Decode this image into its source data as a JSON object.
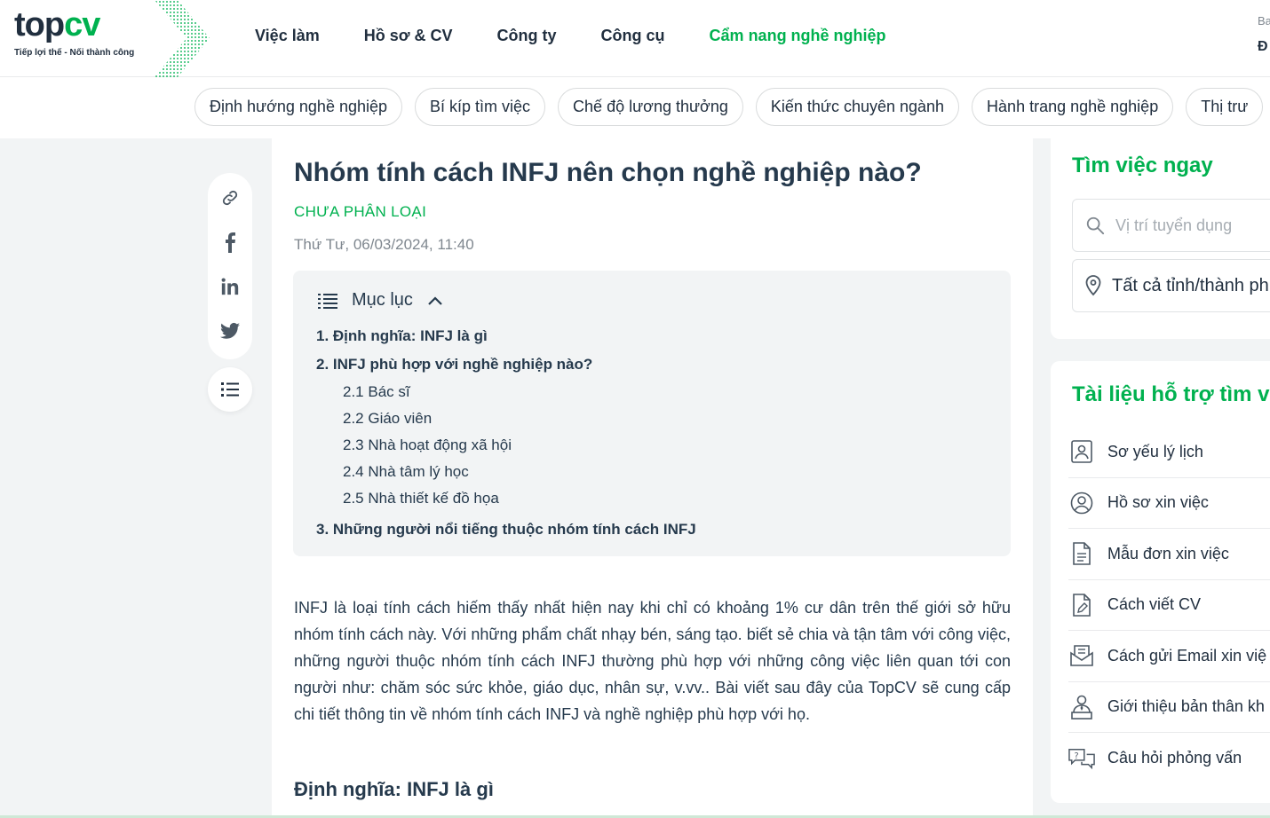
{
  "header": {
    "logo_top": "top",
    "logo_cv": "cv",
    "logo_tagline": "Tiếp lợi thế - Nối thành công",
    "nav": [
      "Việc làm",
      "Hồ sơ & CV",
      "Công ty",
      "Công cụ",
      "Cẩm nang nghề nghiệp"
    ],
    "active_nav": "Cẩm nang nghề nghiệp",
    "right_small": "Ba",
    "right_bold": "Đ"
  },
  "chips": [
    "Định hướng nghề nghiệp",
    "Bí kíp tìm việc",
    "Chế độ lương thưởng",
    "Kiến thức chuyên ngành",
    "Hành trang nghề nghiệp",
    "Thị trư"
  ],
  "article": {
    "title": "Nhóm tính cách INFJ nên chọn nghề nghiệp nào?",
    "category": "CHƯA PHÂN LOẠI",
    "date": "Thứ Tư, 06/03/2024, 11:40",
    "toc_title": "Mục lục",
    "toc": {
      "item1": "1. Định nghĩa: INFJ là gì",
      "item2": "2. INFJ phù hợp với nghề nghiệp nào?",
      "sub1": "2.1 Bác sĩ",
      "sub2": "2.2 Giáo viên",
      "sub3": "2.3 Nhà hoạt động xã hội",
      "sub4": "2.4 Nhà tâm lý học",
      "sub5": "2.5 Nhà thiết kế đồ họa",
      "item3": "3. Những người nổi tiếng thuộc nhóm tính cách INFJ"
    },
    "intro": "INFJ là loại tính cách hiếm thấy nhất hiện nay khi chỉ có khoảng 1% cư dân trên thế giới sở hữu nhóm tính cách này. Với những phẩm chất nhạy bén, sáng tạo. biết sẻ chia và tận tâm với công việc, những người thuộc nhóm tính cách INFJ thường phù hợp với những công việc liên quan tới con người như: chăm sóc sức khỏe, giáo dục, nhân sự, v.vv.. Bài viết sau đây của TopCV sẽ cung cấp chi tiết thông tin về nhóm tính cách INFJ và nghề nghiệp phù hợp với họ.",
    "section_heading": "Định nghĩa: INFJ là gì"
  },
  "sidebar_right": {
    "search_title": "Tìm việc ngay",
    "position_placeholder": "Vị trí tuyển dụng",
    "location_value": "Tất cả tỉnh/thành ph",
    "docs_title": "Tài liệu hỗ trợ tìm v",
    "docs": [
      {
        "label": "Sơ yếu lý lịch",
        "icon": "profile-card-icon"
      },
      {
        "label": "Hồ sơ xin việc",
        "icon": "user-circle-icon"
      },
      {
        "label": "Mẫu đơn xin việc",
        "icon": "document-icon"
      },
      {
        "label": "Cách viết CV",
        "icon": "edit-document-icon"
      },
      {
        "label": "Cách gửi Email xin việ",
        "icon": "email-icon"
      },
      {
        "label": "Giới thiệu bản thân kh",
        "icon": "presenter-icon"
      },
      {
        "label": "Câu hỏi phỏng vấn",
        "icon": "question-chat-icon"
      }
    ]
  },
  "colors": {
    "brand_green": "#00b14f",
    "text_dark": "#263a4d",
    "muted": "#7f878f",
    "panel_bg": "#f2f4f5"
  }
}
